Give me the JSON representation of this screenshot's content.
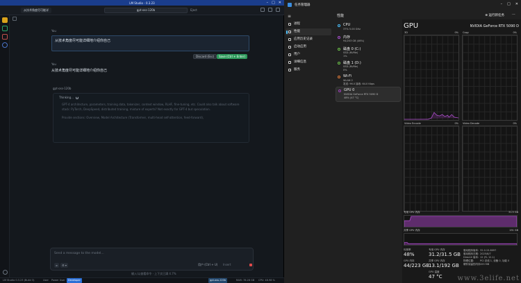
{
  "lm": {
    "title": "LM Studio - 0.3.23",
    "tab": "从技术角度尽可能详",
    "model_pill": "gpt-oss-120b",
    "eject": "Eject",
    "you1": "You",
    "edit_text": "从技术角度尽可能详细地介绍你自己",
    "discard": "Discard (Esc)",
    "save": "Save (Ctrl + Enter)",
    "you2": "You",
    "user_msg": "从技术角度尽可能详细地介绍你自己",
    "assistant_name": "gpt-oss-120b",
    "thinking": "Thinking...",
    "think_p1": "GPT-4 architecture, parameters, training data, tokenizer, context window, RLHF, fine-tuning, etc. Could also talk about software stack: PyTorch, DeepSpeed, distributed training, mixture of experts? Not exactly for GPT-4 but speculation.",
    "think_p2": "Provide sections: Overview, Model Architecture (Transformer, multi-head self-attention, feed-forward),",
    "composer_ph": "Send a message to the model...",
    "user_role": "用户 (Ctrl + U)",
    "insert": "Insert",
    "hint": "输入/以查看命令 · 上下文已满 4.7%",
    "status": {
      "version": "LM Studio 0.3.23 (Build 3)",
      "user": "User",
      "power": "Power User",
      "dev": "Developer",
      "model": "gpt-oss-120b",
      "ram": "RAM: 78.28 GB",
      "cpu": "CPU: 48.98 %"
    }
  },
  "tm": {
    "title": "任务管理器",
    "nav": [
      "进程",
      "性能",
      "应用历史记录",
      "启动应用",
      "用户",
      "详细信息",
      "服务"
    ],
    "settings": "设置",
    "header_title": "性能",
    "run_task": "运行新任务",
    "resources": [
      {
        "name": "CPU",
        "l1": "37% 5.00 GHz",
        "l2": ""
      },
      {
        "name": "内存",
        "l1": "94/203 GB (46%)",
        "l2": ""
      },
      {
        "name": "磁盘 0 (C:)",
        "l1": "SSD (NVMe)",
        "l2": "1%"
      },
      {
        "name": "磁盘 1 (D:)",
        "l1": "SSD (NVMe)",
        "l2": "0%"
      },
      {
        "name": "Wi-Fi",
        "l1": "WLAN 2",
        "l2": "发送: 96.0 接收: 64.0 Kbps"
      },
      {
        "name": "GPU 0",
        "l1": "NVIDIA GeForce RTX 5090 D",
        "l2": "48% (47 °C)"
      }
    ],
    "gpu_title": "GPU",
    "gpu_model": "NVIDIA GeForce RTX 5090 D",
    "graphs": [
      {
        "left": "3D",
        "right": "0%"
      },
      {
        "left": "Copy",
        "right": "0%"
      },
      {
        "left": "Video Encode",
        "right": "0%"
      },
      {
        "left": "Video Decode",
        "right": "0%"
      }
    ],
    "dedicated_label": "专用 GPU 内存",
    "dedicated_max": "31.5 GB",
    "shared_label": "共享 GPU 内存",
    "shared_max": "191 GB",
    "stats": {
      "util_l": "利用率",
      "util_v": "48%",
      "ded_l": "专用 GPU 内存",
      "ded_v": "31.2/31.5 GB",
      "gpu_mem_l": "GPU 内存",
      "gpu_mem_v": "44/223 GB",
      "shared_l": "共享 GPU 内存",
      "shared_v": "13.1/192 GB",
      "temp_l": "GPU 温度",
      "temp_v": "47 °C"
    },
    "info": [
      [
        "驱动程序版本:",
        "32.0.15.8097"
      ],
      [
        "驱动程序日期:",
        "2025/8/7"
      ],
      [
        "DirectX 版本:",
        "12 (FL 12.1)"
      ],
      [
        "物理位置:",
        "PCI 总线 1, 设备 0, 功能 0"
      ],
      [
        "硬件保留的内存:",
        "155 MB"
      ]
    ]
  },
  "watermark": "www.3elife.net",
  "colors": {
    "lm_titlebar": "#1a3d8c",
    "save_green": "#2e9a5c",
    "tm_accent": "#4cc2ff",
    "gpu_purple": "#9b3fb5"
  }
}
